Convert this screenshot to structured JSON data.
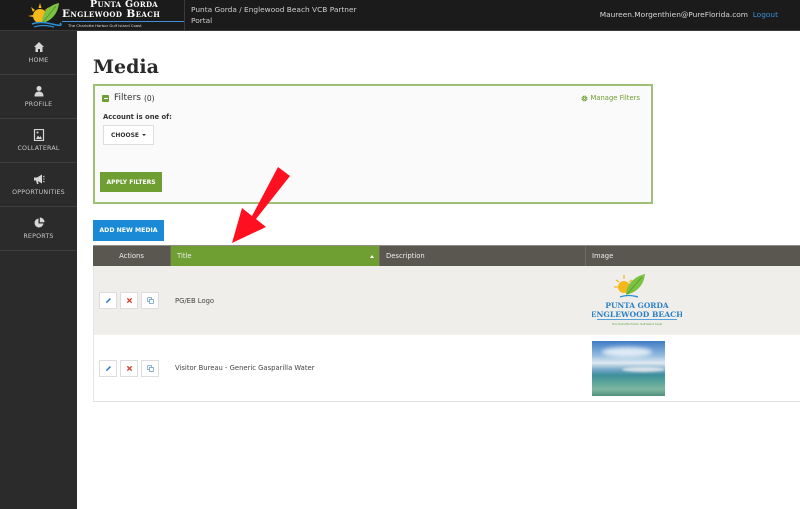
{
  "header": {
    "logo": {
      "line1": "Punta Gorda",
      "line2": "Englewood Beach",
      "tagline": "The Charlotte Harbor Gulf Island Coast"
    },
    "portal_title": "Punta Gorda / Englewood Beach VCB Partner Portal",
    "user_email": "Maureen.Morgenthien@PureFlorida.com",
    "logout_label": "Logout"
  },
  "sidebar": {
    "items": [
      {
        "label": "HOME",
        "icon": "home-icon"
      },
      {
        "label": "PROFILE",
        "icon": "user-icon"
      },
      {
        "label": "COLLATERAL",
        "icon": "document-image-icon"
      },
      {
        "label": "OPPORTUNITIES",
        "icon": "megaphone-icon"
      },
      {
        "label": "REPORTS",
        "icon": "pie-chart-icon"
      }
    ]
  },
  "page": {
    "title": "Media"
  },
  "filters": {
    "label": "Filters",
    "count": "(0)",
    "manage_label": "Manage Filters",
    "account_label": "Account is one of:",
    "choose_label": "CHOOSE",
    "apply_label": "APPLY FILTERS"
  },
  "actions": {
    "add_new_media_label": "ADD NEW MEDIA"
  },
  "table": {
    "columns": [
      "Actions",
      "Title",
      "Description",
      "Image"
    ],
    "sorted_column": "Title",
    "sort_direction": "ascending",
    "rows": [
      {
        "title": "PG/EB Logo",
        "description": "",
        "image": "pg-eb-logo-thumbnail"
      },
      {
        "title": "Visitor Bureau - Generic Gasparilla Water",
        "description": "",
        "image": "beach-water-photo-thumbnail"
      }
    ]
  },
  "colors": {
    "accent_green": "#6f9e33",
    "accent_blue": "#1a8ad6",
    "topbar": "#1b1b1b",
    "sidebar": "#2b2b2b",
    "table_header": "#5a5650",
    "annotation_arrow": "#ff1020"
  }
}
